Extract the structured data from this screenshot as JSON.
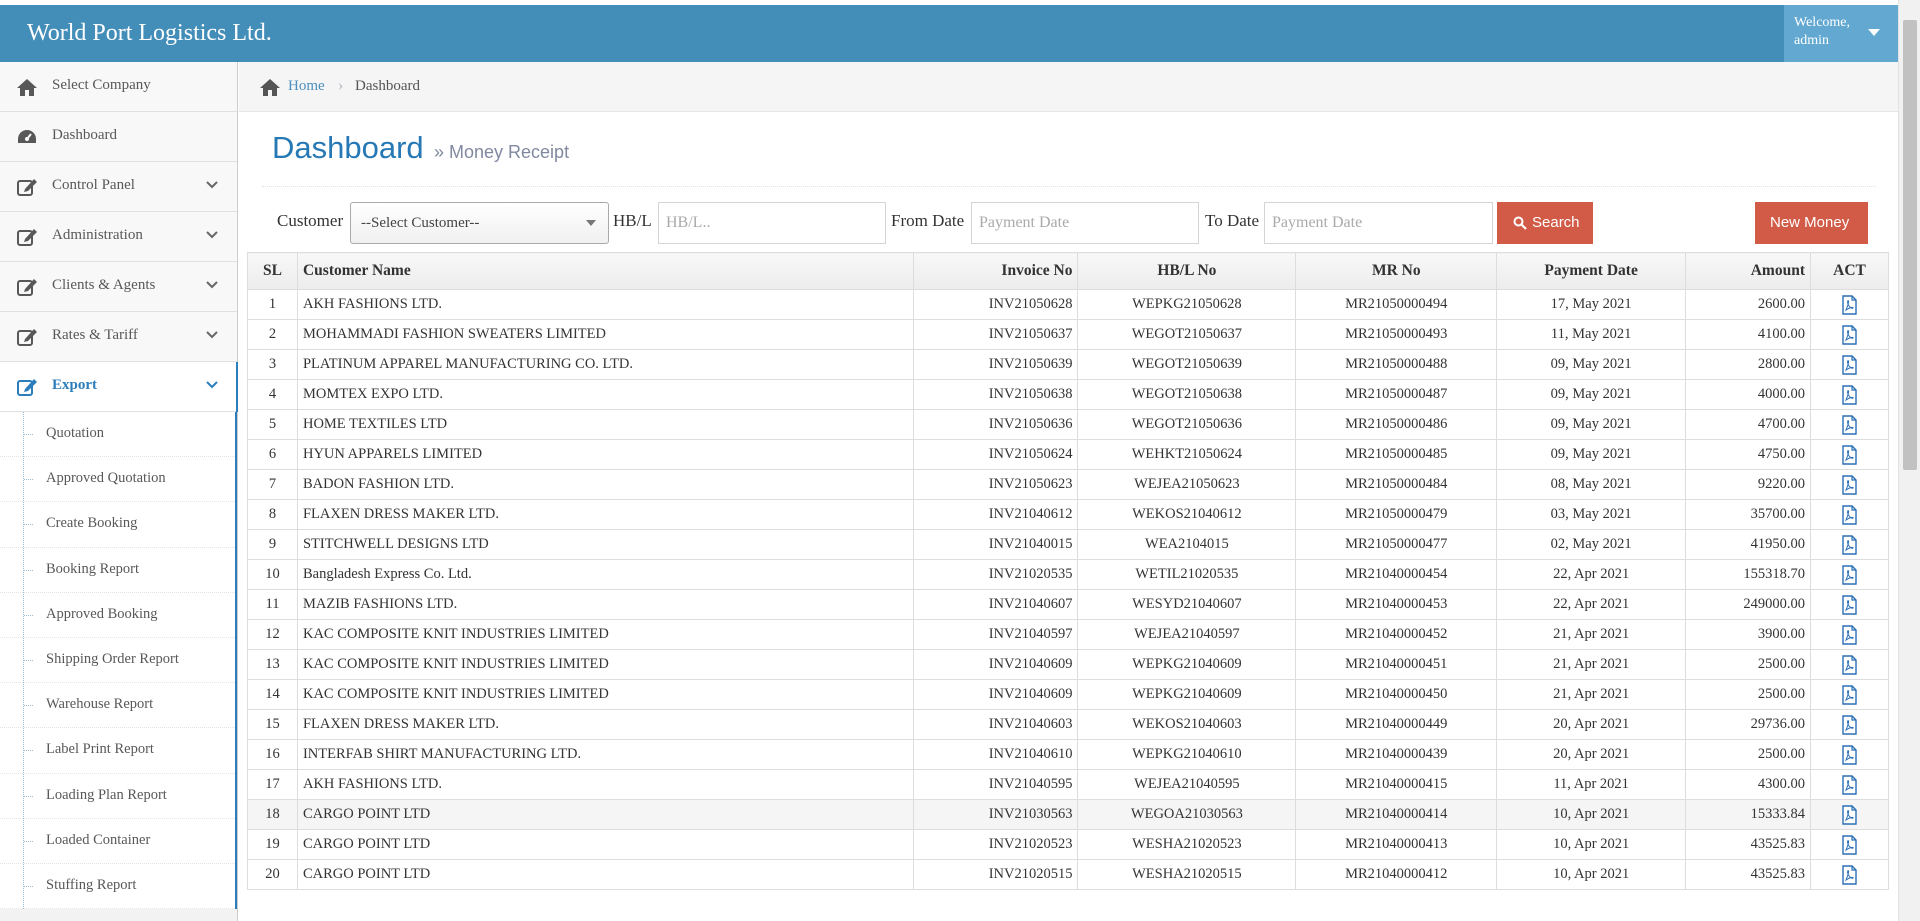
{
  "header": {
    "brand": "World Port Logistics Ltd.",
    "welcome": "Welcome,",
    "user": "admin"
  },
  "sidebar": {
    "items": [
      {
        "label": "Select Company",
        "icon": "home-icon",
        "expandable": false
      },
      {
        "label": "Dashboard",
        "icon": "tachometer-icon",
        "expandable": false
      },
      {
        "label": "Control Panel",
        "icon": "edit-icon",
        "expandable": true
      },
      {
        "label": "Administration",
        "icon": "edit-icon",
        "expandable": true
      },
      {
        "label": "Clients & Agents",
        "icon": "edit-icon",
        "expandable": true
      },
      {
        "label": "Rates & Tariff",
        "icon": "edit-icon",
        "expandable": true
      },
      {
        "label": "Export",
        "icon": "edit-icon",
        "expandable": true,
        "active": true
      }
    ],
    "export_submenu": [
      "Quotation",
      "Approved Quotation",
      "Create Booking",
      "Booking Report",
      "Approved Booking",
      "Shipping Order Report",
      "Warehouse Report",
      "Label Print Report",
      "Loading Plan Report",
      "Loaded Container",
      "Stuffing Report"
    ]
  },
  "breadcrumb": {
    "home": "Home",
    "current": "Dashboard"
  },
  "page": {
    "title": "Dashboard",
    "subtitle": "» Money Receipt"
  },
  "filters": {
    "customer_label": "Customer",
    "customer_value": "--Select Customer--",
    "hbl_label": "HB/L",
    "hbl_placeholder": "HB/L..",
    "from_label": "From Date",
    "from_placeholder": "Payment Date",
    "to_label": "To Date",
    "to_placeholder": "Payment Date",
    "search_label": "Search",
    "new_label": "New Money"
  },
  "table": {
    "headers": [
      "SL",
      "Customer Name",
      "Invoice No",
      "HB/L No",
      "MR No",
      "Payment Date",
      "Amount",
      "ACT"
    ],
    "rows": [
      [
        "1",
        "AKH FASHIONS LTD.",
        "INV21050628",
        "WEPKG21050628",
        "MR21050000494",
        "17, May 2021",
        "2600.00"
      ],
      [
        "2",
        "MOHAMMADI FASHION SWEATERS LIMITED",
        "INV21050637",
        "WEGOT21050637",
        "MR21050000493",
        "11, May 2021",
        "4100.00"
      ],
      [
        "3",
        "PLATINUM APPAREL MANUFACTURING CO. LTD.",
        "INV21050639",
        "WEGOT21050639",
        "MR21050000488",
        "09, May 2021",
        "2800.00"
      ],
      [
        "4",
        "MOMTEX EXPO LTD.",
        "INV21050638",
        "WEGOT21050638",
        "MR21050000487",
        "09, May 2021",
        "4000.00"
      ],
      [
        "5",
        "HOME TEXTILES LTD",
        "INV21050636",
        "WEGOT21050636",
        "MR21050000486",
        "09, May 2021",
        "4700.00"
      ],
      [
        "6",
        "HYUN APPARELS LIMITED",
        "INV21050624",
        "WEHKT21050624",
        "MR21050000485",
        "09, May 2021",
        "4750.00"
      ],
      [
        "7",
        "BADON FASHION LTD.",
        "INV21050623",
        "WEJEA21050623",
        "MR21050000484",
        "08, May 2021",
        "9220.00"
      ],
      [
        "8",
        "FLAXEN DRESS MAKER LTD.",
        "INV21040612",
        "WEKOS21040612",
        "MR21050000479",
        "03, May 2021",
        "35700.00"
      ],
      [
        "9",
        "STITCHWELL DESIGNS LTD",
        "INV21040015",
        "WEA2104015",
        "MR21050000477",
        "02, May 2021",
        "41950.00"
      ],
      [
        "10",
        "Bangladesh Express Co. Ltd.",
        "INV21020535",
        "WETIL21020535",
        "MR21040000454",
        "22, Apr 2021",
        "155318.70"
      ],
      [
        "11",
        "MAZIB FASHIONS LTD.",
        "INV21040607",
        "WESYD21040607",
        "MR21040000453",
        "22, Apr 2021",
        "249000.00"
      ],
      [
        "12",
        "KAC COMPOSITE KNIT INDUSTRIES LIMITED",
        "INV21040597",
        "WEJEA21040597",
        "MR21040000452",
        "21, Apr 2021",
        "3900.00"
      ],
      [
        "13",
        "KAC COMPOSITE KNIT INDUSTRIES LIMITED",
        "INV21040609",
        "WEPKG21040609",
        "MR21040000451",
        "21, Apr 2021",
        "2500.00"
      ],
      [
        "14",
        "KAC COMPOSITE KNIT INDUSTRIES LIMITED",
        "INV21040609",
        "WEPKG21040609",
        "MR21040000450",
        "21, Apr 2021",
        "2500.00"
      ],
      [
        "15",
        "FLAXEN DRESS MAKER LTD.",
        "INV21040603",
        "WEKOS21040603",
        "MR21040000449",
        "20, Apr 2021",
        "29736.00"
      ],
      [
        "16",
        "INTERFAB SHIRT MANUFACTURING LTD.",
        "INV21040610",
        "WEPKG21040610",
        "MR21040000439",
        "20, Apr 2021",
        "2500.00"
      ],
      [
        "17",
        "AKH FASHIONS LTD.",
        "INV21040595",
        "WEJEA21040595",
        "MR21040000415",
        "11, Apr 2021",
        "4300.00"
      ],
      [
        "18",
        "CARGO POINT LTD",
        "INV21030563",
        "WEGOA21030563",
        "MR21040000414",
        "10, Apr 2021",
        "15333.84"
      ],
      [
        "19",
        "CARGO POINT LTD",
        "INV21020523",
        "WESHA21020523",
        "MR21040000413",
        "10, Apr 2021",
        "43525.83"
      ],
      [
        "20",
        "CARGO POINT LTD",
        "INV21020515",
        "WESHA21020515",
        "MR21040000412",
        "10, Apr 2021",
        "43525.83"
      ]
    ],
    "highlighted_row": 18
  },
  "colors": {
    "header_bg": "#438eb9",
    "user_box_bg": "#62a8d1",
    "accent": "#2b7dbc",
    "danger_button": "#d15b47"
  }
}
